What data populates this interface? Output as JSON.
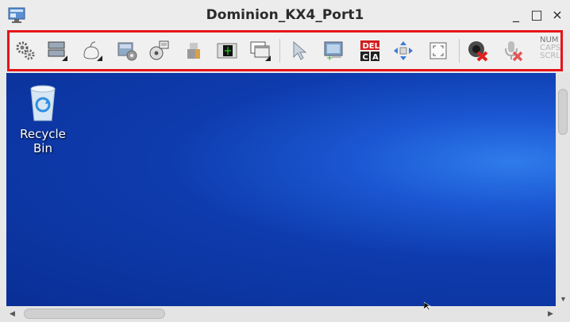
{
  "window": {
    "title": "Dominion_KX4_Port1",
    "minimize_glyph": "_",
    "maximize_glyph": "□",
    "close_glyph": "×"
  },
  "toolbar": {
    "border_color": "#e5141a",
    "buttons": [
      "connection-properties",
      "video-settings",
      "mouse-options",
      "color-calibration",
      "virtual-media",
      "usb-profile",
      "audio",
      "single-cursor",
      "smart-card",
      "ctrl-alt-del",
      "auto-sense-video",
      "full-screen",
      "disconnect",
      "microphone-off"
    ],
    "ctrl_alt_del": {
      "top": "DEL",
      "left": "C",
      "right": "A"
    },
    "lock_keys": {
      "num": "NUM",
      "caps": "CAPS",
      "scroll": "SCRL"
    }
  },
  "desktop": {
    "icon_label": "Recycle Bin",
    "background": "#0c3ab0"
  }
}
